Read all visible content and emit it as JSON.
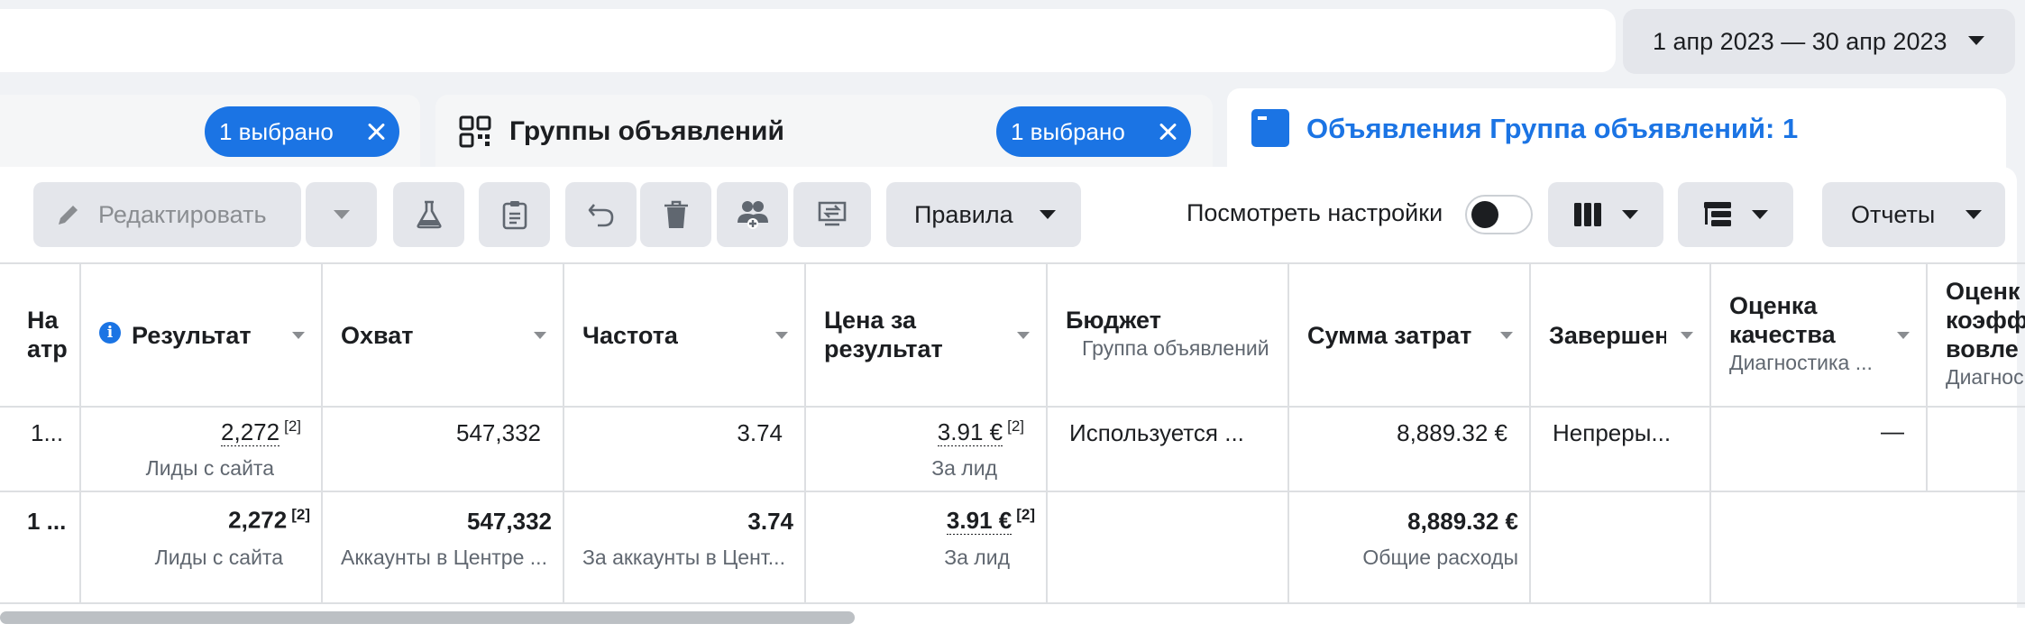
{
  "date_range": {
    "label": "1 апр 2023 — 30 апр 2023"
  },
  "tabs": {
    "campaigns": {
      "chip": "1 выбрано"
    },
    "adsets": {
      "title": "Группы объявлений",
      "chip": "1 выбрано"
    },
    "ads": {
      "title": "Объявления Группа объявлений: 1"
    }
  },
  "toolbar": {
    "edit_label": "Редактировать",
    "rules_label": "Правила",
    "view_settings_label": "Посмотреть настройки",
    "view_settings_on": false,
    "reports_label": "Отчеты",
    "icons": [
      "pencil-icon",
      "flask-icon",
      "clipboard-icon",
      "undo-icon",
      "trash-icon",
      "audience-icon",
      "compare-icon",
      "columns-icon",
      "breakdown-icon"
    ]
  },
  "table": {
    "columns": {
      "first": {
        "line1": "На",
        "line2": "атр"
      },
      "result": {
        "label": "Результат"
      },
      "reach": {
        "label": "Охват"
      },
      "frequency": {
        "label": "Частота"
      },
      "cost_per_result": {
        "line1": "Цена за",
        "line2": "результат"
      },
      "budget": {
        "label": "Бюджет",
        "sub": "Группа объявлений"
      },
      "amount_spent": {
        "label": "Сумма затрат"
      },
      "ends": {
        "label": "Завершен"
      },
      "quality": {
        "line1": "Оценка",
        "line2": "качества",
        "sub": "Диагностика ..."
      },
      "engagement": {
        "line1": "Оценк",
        "line2": "коэфф",
        "line3": "вовле",
        "sub": "Диагнос"
      }
    },
    "row": {
      "first": "1...",
      "result": "2,272",
      "result_note": "[2]",
      "result_sub": "Лиды с сайта",
      "reach": "547,332",
      "frequency": "3.74",
      "cost_per_result": "3.91 €",
      "cost_note": "[2]",
      "cost_sub": "За лид",
      "budget": "Используется ...",
      "amount_spent": "8,889.32 €",
      "ends": "Непреры...",
      "quality": "—"
    },
    "totals": {
      "first": "1 ...",
      "result": "2,272",
      "result_note": "[2]",
      "result_sub": "Лиды с сайта",
      "reach": "547,332",
      "reach_sub": "Аккаунты в Центре ...",
      "frequency": "3.74",
      "frequency_sub": "За аккаунты в Цент...",
      "cost_per_result": "3.91 €",
      "cost_note": "[2]",
      "cost_sub": "За лид",
      "amount_spent": "8,889.32 €",
      "amount_sub": "Общие расходы"
    }
  }
}
